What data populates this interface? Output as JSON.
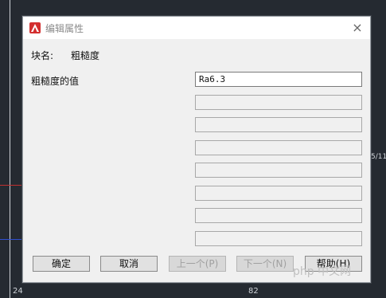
{
  "window": {
    "title": "编辑属性",
    "close_symbol": "×"
  },
  "block": {
    "name_label": "块名:",
    "name_value": "粗糙度"
  },
  "attributes": {
    "label": "粗糙度的值",
    "value": "Ra6.3",
    "empty_rows": 7
  },
  "buttons": {
    "ok": "确定",
    "cancel": "取消",
    "prev": "上一个(P)",
    "next": "下一个(N)",
    "help": "帮助(H)"
  },
  "background": {
    "watermark": "php 中文网",
    "cad_texts": [
      "5/11",
      "24",
      "82"
    ]
  },
  "colors": {
    "app_icon": "#d32f2f",
    "cad_background": "#252a31"
  }
}
